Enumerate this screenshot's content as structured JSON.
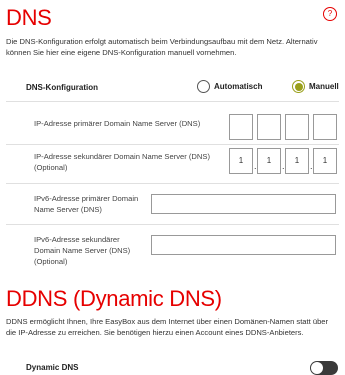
{
  "colors": {
    "accent": "#e60000",
    "selected": "#9aa01c",
    "toggle_off": "#3a3a3a"
  },
  "dns": {
    "title": "DNS",
    "description": "Die DNS-Konfiguration erfolgt automatisch beim Verbindungsaufbau mit dem Netz. Alternativ können Sie hier eine eigene DNS-Konfiguration manuell vornehmen.",
    "config_label": "DNS-Konfiguration",
    "options": [
      {
        "label": "Automatisch",
        "selected": false
      },
      {
        "label": "Manuell",
        "selected": true
      }
    ],
    "primary_label": "IP-Adresse primärer Domain Name Server (DNS)",
    "primary_value": [
      "",
      "",
      "",
      ""
    ],
    "secondary_label": "IP-Adresse sekundärer Domain Name Server (DNS) (Optional)",
    "secondary_value": [
      "1",
      "1",
      "1",
      "1"
    ],
    "ipv6_primary_label": "IPv6-Adresse primärer Domain Name Server (DNS)",
    "ipv6_primary_value": "",
    "ipv6_secondary_label": "IPv6-Adresse sekundärer Domain Name Server (DNS) (Optional)",
    "ipv6_secondary_value": "",
    "help_icon": "help-circle-icon"
  },
  "ddns": {
    "title": "DDNS (Dynamic DNS)",
    "description": "DDNS ermöglicht Ihnen, Ihre EasyBox aus dem Internet über einen Domänen-Namen statt über die IP-Adresse zu erreichen. Sie benötigen hierzu einen Account eines DDNS-Anbieters.",
    "toggle_label": "Dynamic DNS",
    "toggle_on": false
  }
}
